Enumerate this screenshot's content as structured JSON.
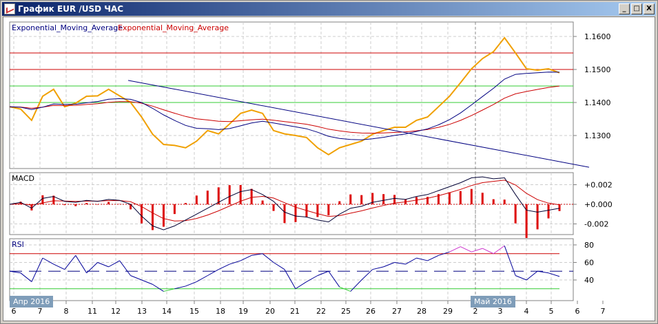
{
  "window": {
    "title": "График EUR /USD  ЧАС",
    "buttons": [
      "_",
      "□",
      "X"
    ]
  },
  "legend": {
    "ema1": "Exponential_Moving_Average",
    "ema2": "Exponential_Moving_Average"
  },
  "macd_label": "MACD",
  "rsi_label": "RSI",
  "months": [
    "Апр 2016",
    "Май 2016"
  ],
  "colors": {
    "price": "#f0a000",
    "ema_fast": "#000080",
    "ema_slow": "#cc0000",
    "resistance": "#cc0000",
    "support": "#33cc33",
    "trend": "#000080",
    "rsi": "#000099",
    "rsi_over": "#cc33cc",
    "rsi_under": "#33cc33"
  },
  "chart_data": [
    {
      "type": "line",
      "title": "EUR/USD H1",
      "y_ticks": [
        "1.1600",
        "1.1500",
        "1.1400",
        "1.1300"
      ],
      "y_tick_values": [
        1.16,
        1.15,
        1.14,
        1.13
      ],
      "x_ticks": [
        "6",
        "7",
        "8",
        "11",
        "12",
        "13",
        "14",
        "15",
        "18",
        "19",
        "20",
        "21",
        "22",
        "25",
        "26",
        "27",
        "28",
        "29",
        "2",
        "3",
        "4",
        "5",
        "6",
        "7"
      ],
      "price": [
        1.1387,
        1.138,
        1.1346,
        1.1419,
        1.144,
        1.1387,
        1.1398,
        1.1419,
        1.142,
        1.144,
        1.142,
        1.14,
        1.1356,
        1.1304,
        1.1273,
        1.127,
        1.1263,
        1.1283,
        1.1315,
        1.1305,
        1.1335,
        1.1367,
        1.1377,
        1.1367,
        1.1315,
        1.1305,
        1.13,
        1.1294,
        1.1263,
        1.1242,
        1.1263,
        1.1273,
        1.1283,
        1.1304,
        1.1315,
        1.1325,
        1.1325,
        1.1346,
        1.1356,
        1.1387,
        1.1419,
        1.146,
        1.1502,
        1.1533,
        1.1554,
        1.1596,
        1.155,
        1.1502,
        1.1498,
        1.1502,
        1.149
      ],
      "ema_periods": [
        10,
        20
      ],
      "horizontal_lines": [
        {
          "value": 1.155,
          "color": "red"
        },
        {
          "value": 1.15,
          "color": "red"
        },
        {
          "value": 1.145,
          "color": "green"
        },
        {
          "value": 1.14,
          "color": "green"
        }
      ],
      "trendline": {
        "start_bar": 13,
        "start_value": 1.1467,
        "end_bar": 62,
        "end_value": 1.1204
      },
      "ylim": [
        1.12,
        1.164
      ]
    },
    {
      "type": "line",
      "title": "MACD",
      "y_ticks": [
        "+0.002",
        "+0.000",
        "-0.002"
      ],
      "y_tick_values": [
        0.002,
        0,
        -0.002
      ],
      "macd": [
        0.0,
        0.0002,
        -0.0004,
        0.0006,
        0.0008,
        0.0003,
        0.0002,
        0.0004,
        0.0003,
        0.0005,
        0.0004,
        0.0,
        -0.0012,
        -0.0022,
        -0.0026,
        -0.0022,
        -0.0016,
        -0.001,
        -0.0004,
        0.0002,
        0.0008,
        0.0013,
        0.0015,
        0.001,
        0.0003,
        -0.0008,
        -0.0012,
        -0.0013,
        -0.0016,
        -0.0018,
        -0.001,
        -0.0004,
        -0.0002,
        0.0002,
        0.0004,
        0.0006,
        0.0005,
        0.0008,
        0.001,
        0.0014,
        0.0018,
        0.0022,
        0.0027,
        0.0028,
        0.0026,
        0.0027,
        0.001,
        -0.0006,
        -0.0008,
        -0.0006,
        -0.0004
      ],
      "signal_period": 5,
      "ylim": [
        -0.0031,
        0.0033
      ]
    },
    {
      "type": "line",
      "title": "RSI",
      "y_ticks": [
        "80",
        "60",
        "40"
      ],
      "levels": {
        "overbought": 70,
        "mid": 50,
        "oversold": 30
      },
      "rsi": [
        50,
        48,
        38,
        65,
        58,
        52,
        68,
        48,
        60,
        55,
        62,
        45,
        40,
        35,
        27,
        30,
        33,
        38,
        45,
        52,
        58,
        62,
        68,
        70,
        60,
        52,
        30,
        38,
        45,
        50,
        32,
        27,
        40,
        52,
        55,
        60,
        58,
        65,
        62,
        68,
        72,
        78,
        72,
        76,
        70,
        79,
        45,
        40,
        50,
        48,
        44
      ],
      "ylim": [
        20,
        86
      ]
    }
  ]
}
